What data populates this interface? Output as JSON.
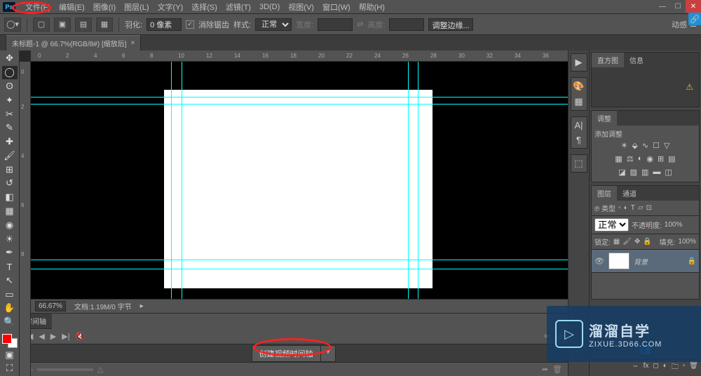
{
  "menu": {
    "items": [
      "文件(F)",
      "编辑(E)",
      "图像(I)",
      "图层(L)",
      "文字(Y)",
      "选择(S)",
      "滤镜(T)",
      "3D(D)",
      "视图(V)",
      "窗口(W)",
      "帮助(H)"
    ]
  },
  "options": {
    "feather_label": "羽化:",
    "feather_value": "0 像素",
    "antialias_label": "消除锯齿",
    "style_label": "样式:",
    "style_value": "正常",
    "width_label": "宽度:",
    "height_label": "高度:",
    "refine_edge": "调整边缘...",
    "right_label": "动感"
  },
  "doc_tab": {
    "title": "未标题-1 @ 66.7%(RGB/8#) [缩放后]"
  },
  "ruler_h": [
    "0",
    "2",
    "4",
    "6",
    "8",
    "10",
    "12",
    "14",
    "16",
    "18",
    "20",
    "22",
    "24",
    "26",
    "28",
    "30",
    "32",
    "34",
    "36"
  ],
  "ruler_v": [
    "0",
    "2",
    "4",
    "6",
    "8"
  ],
  "status": {
    "zoom": "66.67%",
    "doc_info": "文档:1.19M/0 字节"
  },
  "timeline": {
    "tab": "时间轴",
    "create_btn": "创建视频时间轴"
  },
  "panels": {
    "histogram": {
      "tabs": [
        "直方图",
        "信息"
      ]
    },
    "adjust": {
      "tab": "调整",
      "title": "添加调整"
    },
    "layers": {
      "tabs": [
        "图层",
        "通道"
      ],
      "kind_label": "℗ 类型",
      "blend_mode": "正常",
      "opacity_label": "不透明度:",
      "opacity_value": "100%",
      "lock_label": "锁定:",
      "fill_label": "填充:",
      "fill_value": "100%",
      "layer": {
        "name": "背景"
      }
    }
  },
  "watermark": {
    "title": "溜溜自学",
    "sub": "ZIXUE.3D66.COM"
  },
  "ps_label": "Ps"
}
